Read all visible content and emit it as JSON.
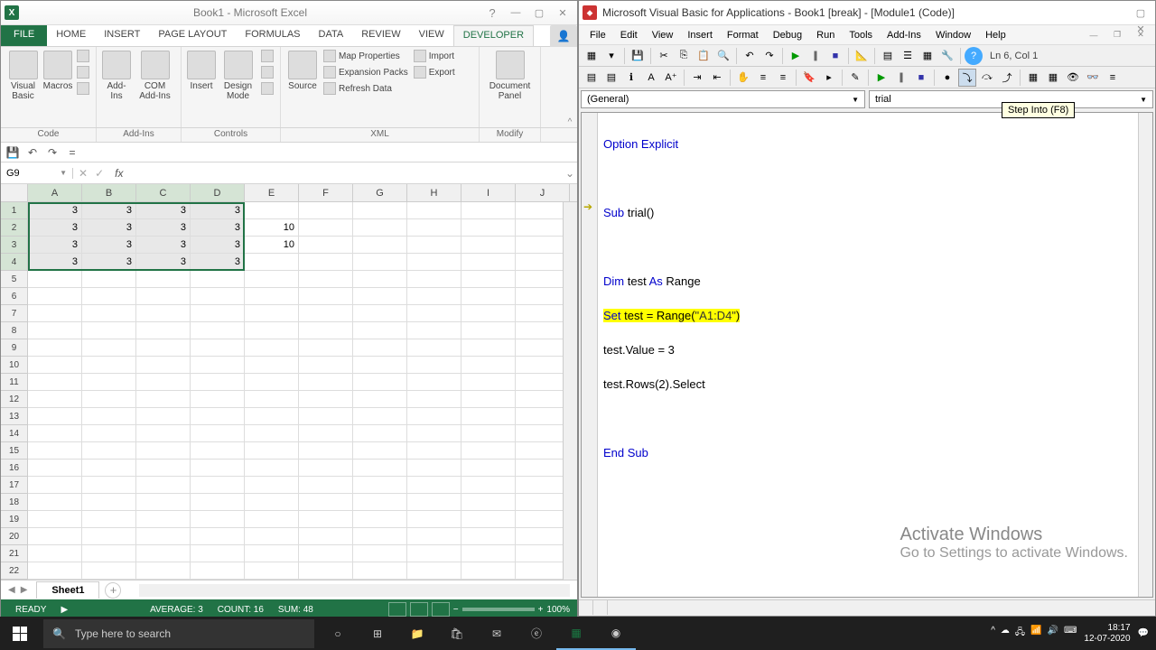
{
  "excel": {
    "title": "Book1 - Microsoft Excel",
    "tabs": {
      "file": "FILE",
      "home": "HOME",
      "insert": "INSERT",
      "page_layout": "PAGE LAYOUT",
      "formulas": "FORMULAS",
      "data": "DATA",
      "review": "REVIEW",
      "view": "VIEW",
      "developer": "DEVELOPER"
    },
    "ribbon": {
      "visual_basic": "Visual Basic",
      "macros": "Macros",
      "addins": "Add-Ins",
      "com_addins": "COM Add-Ins",
      "insert": "Insert",
      "design_mode": "Design Mode",
      "source": "Source",
      "document_panel": "Document Panel",
      "map_properties": "Map Properties",
      "expansion_packs": "Expansion Packs",
      "refresh_data": "Refresh Data",
      "import": "Import",
      "export": "Export"
    },
    "group_labels": {
      "code": "Code",
      "addins": "Add-Ins",
      "controls": "Controls",
      "xml": "XML",
      "modify": "Modify"
    },
    "namebox": "G9",
    "columns": [
      "A",
      "B",
      "C",
      "D",
      "E",
      "F",
      "G",
      "H",
      "I",
      "J"
    ],
    "rows": 22,
    "data_rows": [
      {
        "r": 1,
        "cells": [
          "3",
          "3",
          "3",
          "3",
          "",
          "",
          "",
          "",
          "",
          ""
        ]
      },
      {
        "r": 2,
        "cells": [
          "3",
          "3",
          "3",
          "3",
          "10",
          "",
          "",
          "",
          "",
          ""
        ]
      },
      {
        "r": 3,
        "cells": [
          "3",
          "3",
          "3",
          "3",
          "10",
          "",
          "",
          "",
          "",
          ""
        ]
      },
      {
        "r": 4,
        "cells": [
          "3",
          "3",
          "3",
          "3",
          "",
          "",
          "",
          "",
          "",
          ""
        ]
      }
    ],
    "sheet_tab": "Sheet1",
    "status": {
      "ready": "READY",
      "average": "AVERAGE: 3",
      "count": "COUNT: 16",
      "sum": "SUM: 48",
      "zoom": "100%"
    }
  },
  "vba": {
    "title": "Microsoft Visual Basic for Applications - Book1 [break] - [Module1 (Code)]",
    "menus": [
      "File",
      "Edit",
      "View",
      "Insert",
      "Format",
      "Debug",
      "Run",
      "Tools",
      "Add-Ins",
      "Window",
      "Help"
    ],
    "cursor_pos": "Ln 6, Col 1",
    "combo_left": "(General)",
    "combo_right": "trial",
    "tooltip": "Step Into (F8)",
    "code": {
      "l1": "Option Explicit",
      "l3": "Sub trial()",
      "l5": "Dim test As Range",
      "l6": "Set test = Range(\"A1:D4\")",
      "l7": "test.Value = 3",
      "l8": "test.Rows(2).Select",
      "l10": "End Sub"
    },
    "watermark": {
      "title": "Activate Windows",
      "sub": "Go to Settings to activate Windows."
    }
  },
  "taskbar": {
    "search_placeholder": "Type here to search",
    "time": "18:17",
    "date": "12-07-2020"
  }
}
